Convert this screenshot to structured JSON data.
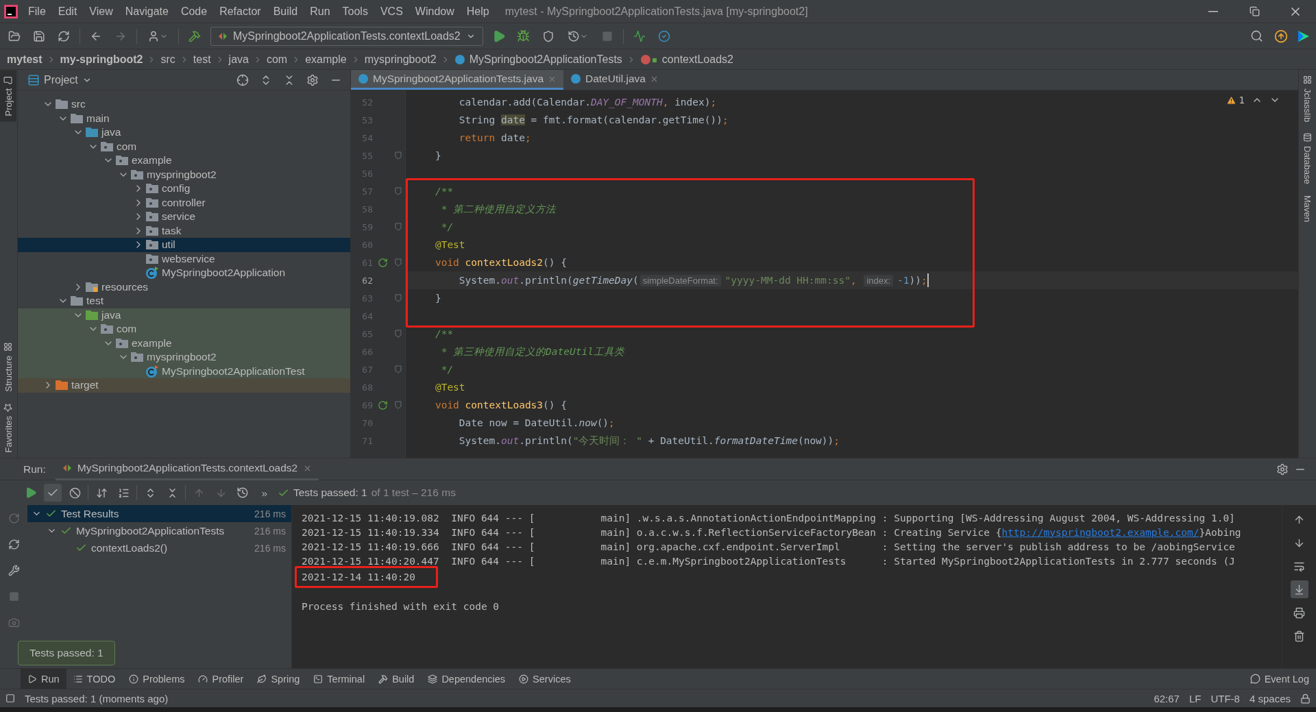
{
  "window": {
    "title": "mytest - MySpringboot2ApplicationTests.java [my-springboot2]"
  },
  "menu": [
    "File",
    "Edit",
    "View",
    "Navigate",
    "Code",
    "Refactor",
    "Build",
    "Run",
    "Tools",
    "VCS",
    "Window",
    "Help"
  ],
  "toolbar": {
    "run_config": "MySpringboot2ApplicationTests.contextLoads2"
  },
  "breadcrumbs": [
    {
      "label": "mytest",
      "kind": "project"
    },
    {
      "label": "my-springboot2",
      "kind": "project"
    },
    {
      "label": "src",
      "kind": "dir"
    },
    {
      "label": "test",
      "kind": "dir"
    },
    {
      "label": "java",
      "kind": "dir"
    },
    {
      "label": "com",
      "kind": "dir"
    },
    {
      "label": "example",
      "kind": "dir"
    },
    {
      "label": "myspringboot2",
      "kind": "dir"
    },
    {
      "label": "MySpringboot2ApplicationTests",
      "kind": "class"
    },
    {
      "label": "contextLoads2",
      "kind": "method"
    }
  ],
  "left_stripe": {
    "top": [
      {
        "label": "Project",
        "selected": true
      }
    ],
    "bottom": [
      {
        "label": "Structure",
        "selected": false
      },
      {
        "label": "Favorites",
        "selected": false
      }
    ]
  },
  "right_stripe": [
    {
      "label": "Jclasslib",
      "selected": false
    },
    {
      "label": "Database",
      "selected": false
    },
    {
      "label": "Maven",
      "selected": false
    }
  ],
  "project": {
    "title": "Project",
    "tree": [
      {
        "label": "src",
        "kind": "folder",
        "expanded": true,
        "children": [
          {
            "label": "main",
            "kind": "folder",
            "expanded": true,
            "children": [
              {
                "label": "java",
                "kind": "source",
                "expanded": true,
                "children": [
                  {
                    "label": "com",
                    "kind": "package",
                    "expanded": true,
                    "children": [
                      {
                        "label": "example",
                        "kind": "package",
                        "expanded": true,
                        "children": [
                          {
                            "label": "myspringboot2",
                            "kind": "package",
                            "expanded": true,
                            "children": [
                              {
                                "label": "config",
                                "kind": "package",
                                "expanded": false,
                                "selected": false
                              },
                              {
                                "label": "controller",
                                "kind": "package",
                                "expanded": false,
                                "selected": false
                              },
                              {
                                "label": "service",
                                "kind": "package",
                                "expanded": false,
                                "selected": false
                              },
                              {
                                "label": "task",
                                "kind": "package",
                                "expanded": false,
                                "selected": false
                              },
                              {
                                "label": "util",
                                "kind": "package",
                                "expanded": false,
                                "selected": true
                              },
                              {
                                "label": "webservice",
                                "kind": "package",
                                "selected": false
                              },
                              {
                                "label": "MySpringboot2Application",
                                "kind": "app-class",
                                "selected": false
                              }
                            ]
                          }
                        ]
                      }
                    ]
                  }
                ]
              },
              {
                "label": "resources",
                "kind": "resources",
                "expanded": false
              }
            ]
          },
          {
            "label": "test",
            "kind": "folder",
            "expanded": true,
            "children": [
              {
                "label": "java",
                "kind": "test-source",
                "expanded": true,
                "children": [
                  {
                    "label": "com",
                    "kind": "package",
                    "expanded": true,
                    "children": [
                      {
                        "label": "example",
                        "kind": "package",
                        "expanded": true,
                        "children": [
                          {
                            "label": "myspringboot2",
                            "kind": "package",
                            "expanded": true,
                            "children": [
                              {
                                "label": "MySpringboot2ApplicationTest",
                                "kind": "test-class"
                              }
                            ]
                          }
                        ]
                      }
                    ]
                  }
                ]
              }
            ]
          }
        ]
      },
      {
        "label": "target",
        "kind": "excluded",
        "expanded": false
      }
    ]
  },
  "editor": {
    "tabs": [
      {
        "label": "MySpringboot2ApplicationTests.java",
        "selected": true
      },
      {
        "label": "DateUtil.java",
        "selected": false
      }
    ],
    "warnings": "1",
    "lines": [
      {
        "number": "52",
        "tokens": [
          {
            "kind": "plain",
            "text": "        calendar.add(Calendar."
          },
          {
            "kind": "field",
            "text": "DAY_OF_MONTH"
          },
          {
            "kind": "keyword",
            "text": ", "
          },
          {
            "kind": "plain",
            "text": "index)"
          },
          {
            "kind": "keyword",
            "text": ";"
          }
        ]
      },
      {
        "number": "53",
        "tokens": [
          {
            "kind": "plain",
            "text": "        String "
          },
          {
            "kind": "highlight",
            "text": "date"
          },
          {
            "kind": "plain",
            "text": " = fmt.format(calendar.getTime())"
          },
          {
            "kind": "keyword",
            "text": ";"
          }
        ]
      },
      {
        "number": "54",
        "tokens": [
          {
            "kind": "keyword",
            "text": "        return "
          },
          {
            "kind": "plain",
            "text": "date"
          },
          {
            "kind": "keyword",
            "text": ";"
          }
        ]
      },
      {
        "number": "55",
        "fold": true,
        "tokens": [
          {
            "kind": "plain",
            "text": "    }"
          }
        ]
      },
      {
        "number": "56"
      },
      {
        "number": "57",
        "fold": true,
        "framed": true,
        "tokens": [
          {
            "kind": "comment",
            "text": "    /**"
          }
        ]
      },
      {
        "number": "58",
        "framed": true,
        "tokens": [
          {
            "kind": "comment",
            "text": "     * 第二种使用自定义方法"
          }
        ]
      },
      {
        "number": "59",
        "fold": true,
        "framed": true,
        "tokens": [
          {
            "kind": "comment",
            "text": "     */"
          }
        ]
      },
      {
        "number": "60",
        "framed": true,
        "tokens": [
          {
            "kind": "annotation",
            "text": "    @Test"
          }
        ]
      },
      {
        "number": "61",
        "fold": true,
        "run_marker": true,
        "framed": true,
        "tokens": [
          {
            "kind": "keyword",
            "text": "    void "
          },
          {
            "kind": "method",
            "text": "contextLoads2"
          },
          {
            "kind": "plain",
            "text": "() {"
          }
        ]
      },
      {
        "number": "62",
        "current": true,
        "framed": true,
        "tokens": [
          {
            "kind": "plain",
            "text": "        System."
          },
          {
            "kind": "field",
            "text": "out"
          },
          {
            "kind": "plain",
            "text": ".println("
          },
          {
            "kind": "static",
            "text": "getTimeDay"
          },
          {
            "kind": "plain",
            "text": "("
          },
          {
            "kind": "hint",
            "text": "simpleDateFormat:"
          },
          {
            "kind": "string",
            "text": "\"yyyy-MM-dd HH:mm:ss\""
          },
          {
            "kind": "keyword",
            "text": ", "
          },
          {
            "kind": "hint",
            "text": "index:"
          },
          {
            "kind": "number",
            "text": "-1"
          },
          {
            "kind": "plain",
            "text": "))"
          },
          {
            "kind": "keyword",
            "text": ";"
          }
        ]
      },
      {
        "number": "63",
        "fold": true,
        "framed": true,
        "tokens": [
          {
            "kind": "plain",
            "text": "    }"
          }
        ]
      },
      {
        "number": "64",
        "framed": true
      },
      {
        "number": "65",
        "fold": true,
        "tokens": [
          {
            "kind": "comment",
            "text": "    /**"
          }
        ]
      },
      {
        "number": "66",
        "tokens": [
          {
            "kind": "comment",
            "text": "     * 第三种使用自定义的DateUtil工具类"
          }
        ]
      },
      {
        "number": "67",
        "fold": true,
        "tokens": [
          {
            "kind": "comment",
            "text": "     */"
          }
        ]
      },
      {
        "number": "68",
        "tokens": [
          {
            "kind": "annotation",
            "text": "    @Test"
          }
        ]
      },
      {
        "number": "69",
        "fold": true,
        "run_marker": true,
        "tokens": [
          {
            "kind": "keyword",
            "text": "    void "
          },
          {
            "kind": "method",
            "text": "contextLoads3"
          },
          {
            "kind": "plain",
            "text": "() {"
          }
        ]
      },
      {
        "number": "70",
        "tokens": [
          {
            "kind": "plain",
            "text": "        Date now = DateUtil."
          },
          {
            "kind": "static",
            "text": "now"
          },
          {
            "kind": "plain",
            "text": "()"
          },
          {
            "kind": "keyword",
            "text": ";"
          }
        ]
      },
      {
        "number": "71",
        "tokens": [
          {
            "kind": "plain",
            "text": "        System."
          },
          {
            "kind": "field",
            "text": "out"
          },
          {
            "kind": "plain",
            "text": ".println("
          },
          {
            "kind": "string",
            "text": "\"今天时间： \""
          },
          {
            "kind": "plain",
            "text": " + DateUtil."
          },
          {
            "kind": "static",
            "text": "formatDateTime"
          },
          {
            "kind": "plain",
            "text": "(now))"
          },
          {
            "kind": "keyword",
            "text": ";"
          }
        ]
      }
    ]
  },
  "run": {
    "label": "Run:",
    "tab": "MySpringboot2ApplicationTests.contextLoads2",
    "filters": [
      {
        "kind": "passed",
        "selected": true
      },
      {
        "kind": "ignored",
        "selected": false
      }
    ],
    "more": "»",
    "summary": {
      "passed": "Tests passed: 1",
      "rest": " of 1 test – 216 ms"
    },
    "tests": [
      {
        "label": "Test Results",
        "time": "216 ms",
        "selected": true,
        "expanded": true,
        "children": [
          {
            "label": "MySpringboot2ApplicationTests",
            "time": "216 ms",
            "selected": false,
            "expanded": true,
            "children": [
              {
                "label": "contextLoads2()",
                "time": "216 ms",
                "selected": false
              }
            ]
          }
        ]
      }
    ],
    "console": [
      {
        "kind": "log",
        "text": "2021-12-15 11:40:19.082  INFO 644 --- [           main] .w.s.a.s.AnnotationActionEndpointMapping : Supporting [WS-Addressing August 2004, WS-Addressing 1.0]"
      },
      {
        "kind": "log",
        "text": "2021-12-15 11:40:19.334  INFO 644 --- [           main] o.a.c.w.s.f.ReflectionServiceFactoryBean : Creating Service {",
        "link": "http://myspringboot2.example.com/",
        "after": "}Aobing"
      },
      {
        "kind": "log",
        "text": "2021-12-15 11:40:19.666  INFO 644 --- [           main] org.apache.cxf.endpoint.ServerImpl       : Setting the server's publish address to be /aobingService"
      },
      {
        "kind": "log",
        "text": "2021-12-15 11:40:20.447  INFO 644 --- [           main] c.e.m.MySpringboot2ApplicationTests      : Started MySpringboot2ApplicationTests in 2.777 seconds (J"
      },
      {
        "kind": "log",
        "text": "2021-12-14 11:40:20",
        "framed": true
      },
      {
        "kind": "blank"
      },
      {
        "kind": "log",
        "text": "Process finished with exit code 0"
      }
    ],
    "tooltip": "Tests passed: 1"
  },
  "tool_tabs": [
    {
      "label": "Run",
      "kind": "run",
      "selected": true
    },
    {
      "label": "TODO",
      "kind": "todo",
      "selected": false
    },
    {
      "label": "Problems",
      "kind": "problems",
      "selected": false
    },
    {
      "label": "Profiler",
      "kind": "profiler",
      "selected": false
    },
    {
      "label": "Spring",
      "kind": "spring",
      "selected": false
    },
    {
      "label": "Terminal",
      "kind": "terminal",
      "selected": false
    },
    {
      "label": "Build",
      "kind": "build",
      "selected": false
    },
    {
      "label": "Dependencies",
      "kind": "dependencies",
      "selected": false
    },
    {
      "label": "Services",
      "kind": "services",
      "selected": false
    }
  ],
  "event_log": "Event Log",
  "status_bar": {
    "message": "Tests passed: 1 (moments ago)",
    "items": [
      "62:67",
      "LF",
      "UTF-8",
      "4 spaces"
    ]
  }
}
